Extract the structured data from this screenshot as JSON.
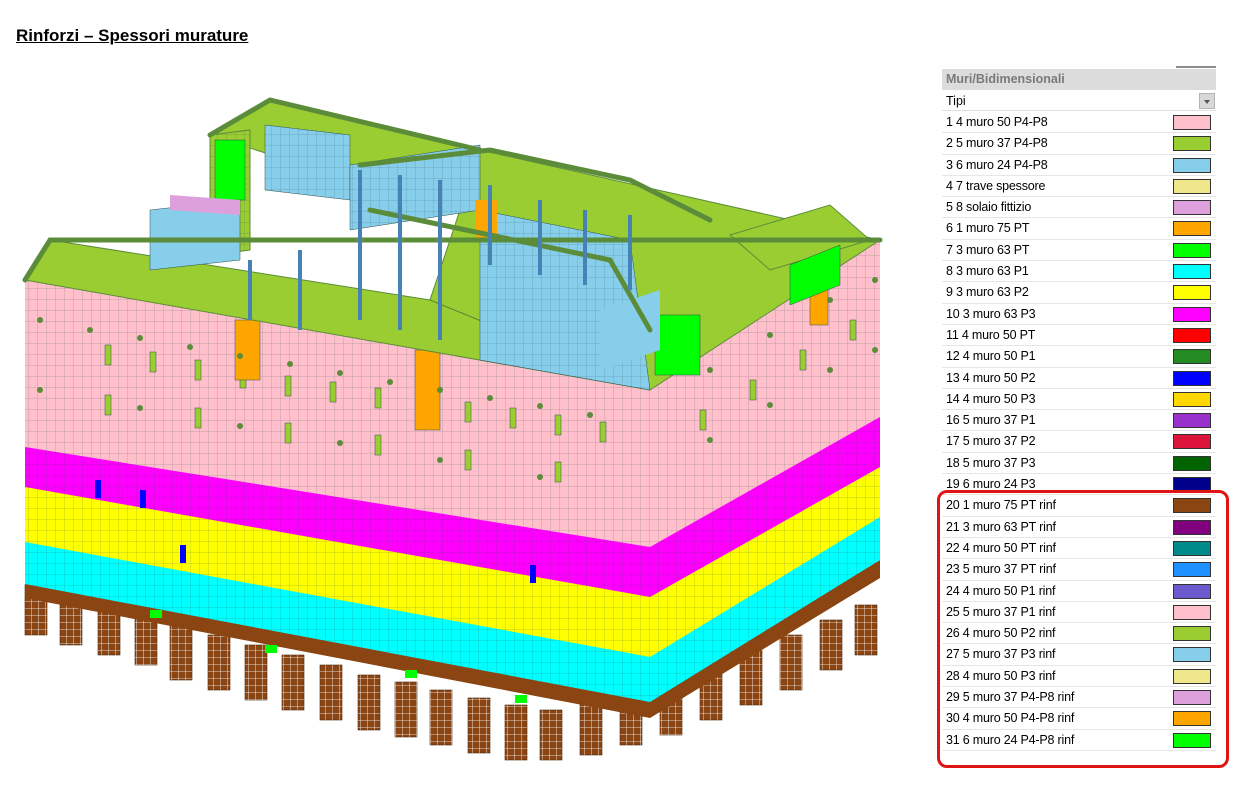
{
  "page": {
    "title": "Rinforzi – Spessori murature"
  },
  "panel": {
    "header": "Muri/Bidimensionali",
    "dropdown_value": "Tipi",
    "items": [
      {
        "label": "1 4 muro 50 P4-P8",
        "color": "#FFC0CB"
      },
      {
        "label": "2 5 muro 37 P4-P8",
        "color": "#9ACD32"
      },
      {
        "label": "3 6 muro 24 P4-P8",
        "color": "#87CEEB"
      },
      {
        "label": "4 7 trave spessore",
        "color": "#F0E68C"
      },
      {
        "label": "5 8 solaio fittizio",
        "color": "#DDA0DD"
      },
      {
        "label": "6 1 muro 75 PT",
        "color": "#FFA500"
      },
      {
        "label": "7 3 muro 63 PT",
        "color": "#00FF00"
      },
      {
        "label": "8 3 muro 63 P1",
        "color": "#00FFFF"
      },
      {
        "label": "9 3 muro 63 P2",
        "color": "#FFFF00"
      },
      {
        "label": "10 3 muro 63 P3",
        "color": "#FF00FF"
      },
      {
        "label": "11 4 muro 50 PT",
        "color": "#FF0000"
      },
      {
        "label": "12 4 muro 50 P1",
        "color": "#228B22"
      },
      {
        "label": "13 4 muro 50 P2",
        "color": "#0000FF"
      },
      {
        "label": "14 4 muro 50 P3",
        "color": "#FFD700"
      },
      {
        "label": "16 5 muro 37 P1",
        "color": "#9932CC"
      },
      {
        "label": "17 5 muro 37 P2",
        "color": "#DC143C"
      },
      {
        "label": "18 5 muro 37 P3",
        "color": "#006400"
      },
      {
        "label": "19 6 muro 24 P3",
        "color": "#00008B"
      },
      {
        "label": "20 1 muro 75 PT rinf",
        "color": "#8B4513"
      },
      {
        "label": "21 3 muro 63 PT rinf",
        "color": "#800080"
      },
      {
        "label": "22 4 muro 50 PT rinf",
        "color": "#008B8B"
      },
      {
        "label": "23 5 muro 37 PT rinf",
        "color": "#1E90FF"
      },
      {
        "label": "24 4 muro 50 P1 rinf",
        "color": "#6A5ACD"
      },
      {
        "label": "25 5 muro 37 P1 rinf",
        "color": "#FFC0CB"
      },
      {
        "label": "26 4 muro 50 P2 rinf",
        "color": "#9ACD32"
      },
      {
        "label": "27 5 muro 37 P3 rinf",
        "color": "#87CEEB"
      },
      {
        "label": "28 4 muro 50 P3 rinf",
        "color": "#F0E68C"
      },
      {
        "label": "29 5 muro 37 P4-P8 rinf",
        "color": "#DDA0DD"
      },
      {
        "label": "30 4 muro 50 P4-P8 rinf",
        "color": "#FFA500"
      },
      {
        "label": "31 6 muro 24 P4-P8 rinf",
        "color": "#00FF00"
      }
    ]
  },
  "colors": {
    "highlight": "#E01414",
    "grid_line": "#2F4F4F",
    "wall_edge": "#5B8C3A"
  }
}
